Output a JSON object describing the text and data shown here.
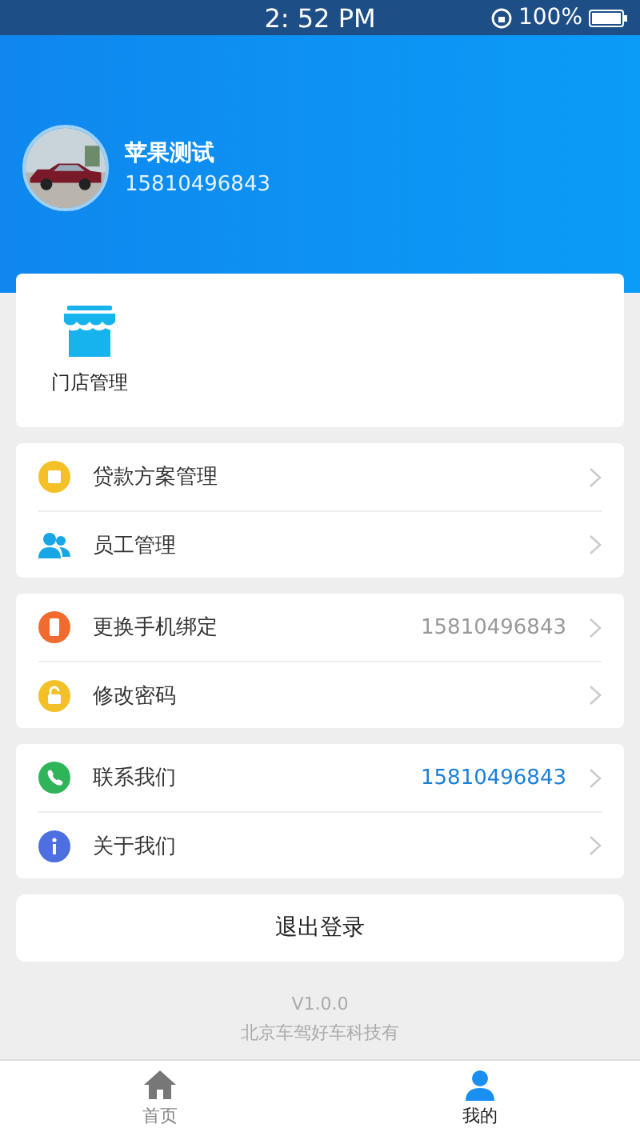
{
  "status_bar": {
    "time": "2: 52 PM",
    "battery": "100%"
  },
  "profile": {
    "name": "苹果测试",
    "phone": "15810496843"
  },
  "shortcuts": [
    {
      "label": "门店管理"
    }
  ],
  "groups": [
    [
      {
        "kind": "loan",
        "label": "贷款方案管理"
      },
      {
        "kind": "staff",
        "label": "员工管理"
      }
    ],
    [
      {
        "kind": "phone",
        "label": "更换手机绑定",
        "value": "15810496843",
        "highlight": false
      },
      {
        "kind": "lock",
        "label": "修改密码"
      }
    ],
    [
      {
        "kind": "call",
        "label": "联系我们",
        "value": "15810496843",
        "highlight": true
      },
      {
        "kind": "info",
        "label": "关于我们"
      }
    ]
  ],
  "logout": "退出登录",
  "footer": {
    "version": "V1.0.0",
    "company": "北京车驾好车科技有"
  },
  "tabs": [
    {
      "kind": "home",
      "label": "首页",
      "selected": false
    },
    {
      "kind": "me",
      "label": "我的",
      "selected": true
    }
  ]
}
